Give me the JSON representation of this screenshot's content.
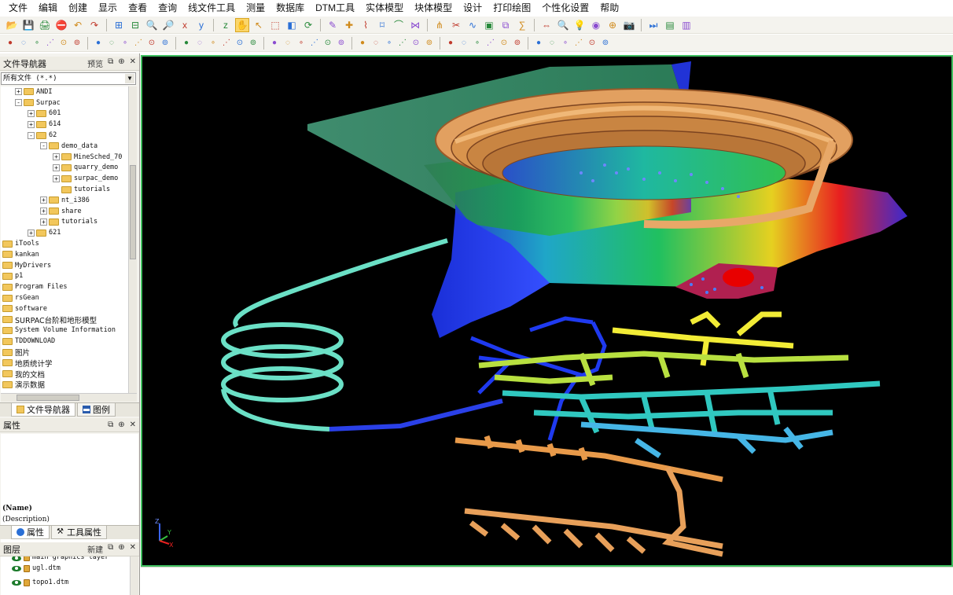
{
  "menubar": {
    "items": [
      "文件",
      "编辑",
      "创建",
      "显示",
      "查看",
      "查询",
      "线文件工具",
      "测量",
      "数据库",
      "DTM工具",
      "实体模型",
      "块体模型",
      "设计",
      "打印绘图",
      "个性化设置",
      "帮助"
    ]
  },
  "toolbar1": {
    "icons": [
      "open-icon",
      "save-icon",
      "print-icon",
      "stop-icon",
      "undo-icon",
      "redo-icon",
      "zoom-box-icon",
      "zoom-fit-icon",
      "zoom-in-icon",
      "zoom-out-icon",
      "axis-x-icon",
      "axis-y-icon",
      "axis-z-icon",
      "pan-icon",
      "select-arrow-icon",
      "select-box-icon",
      "layer-tool-icon",
      "refresh-icon",
      "digitize-icon",
      "crosshair-icon",
      "edit-string-icon",
      "edit-point-icon",
      "edit-segment-icon",
      "join-icon",
      "split-icon",
      "clip-icon",
      "curve-icon",
      "image-icon",
      "copy-icon",
      "calc-icon",
      "move-icon",
      "search-icon",
      "pin-icon",
      "target-icon",
      "snap-icon",
      "photo-icon",
      "next-icon",
      "tool-a-icon",
      "tool-b-icon"
    ]
  },
  "toolbar2": {
    "icons": [
      "pt-1-icon",
      "pt-2-icon",
      "pt-3-icon",
      "pt-4-icon",
      "pt-5-icon",
      "pt-6-icon",
      "pt-7-icon",
      "pt-8-icon",
      "pt-9-icon",
      "pt-10-icon",
      "pt-11-icon",
      "pt-12-icon",
      "pt-13-icon",
      "pt-14-icon",
      "pt-15-icon",
      "pt-16-icon",
      "pt-17-icon",
      "pt-18-icon",
      "pt-19-icon",
      "pt-20-icon",
      "pt-21-icon",
      "pt-22-icon",
      "pt-23-icon",
      "pt-24-icon",
      "pt-25-icon",
      "pt-26-icon",
      "pt-27-icon",
      "pt-28-icon",
      "pt-29-icon",
      "pt-30-icon",
      "pt-31-icon",
      "pt-32-icon",
      "pt-33-icon",
      "pt-34-icon",
      "pt-35-icon",
      "pt-36-icon",
      "pt-37-icon",
      "pt-38-icon",
      "pt-39-icon",
      "pt-40-icon",
      "pt-41-icon",
      "pt-42-icon"
    ]
  },
  "navigator": {
    "title": "文件导航器",
    "preview_label": "预览",
    "filter_value": "所有文件 (*.*)",
    "tree": [
      {
        "label": "ANDI",
        "depth": 1,
        "expander": "+"
      },
      {
        "label": "Surpac",
        "depth": 1,
        "expander": "-"
      },
      {
        "label": "601",
        "depth": 2,
        "expander": "+"
      },
      {
        "label": "614",
        "depth": 2,
        "expander": "+"
      },
      {
        "label": "62",
        "depth": 2,
        "expander": "-"
      },
      {
        "label": "demo_data",
        "depth": 3,
        "expander": "-"
      },
      {
        "label": "MineSched_70",
        "depth": 4,
        "expander": "+"
      },
      {
        "label": "quarry_demo",
        "depth": 4,
        "expander": "+"
      },
      {
        "label": "surpac_demo",
        "depth": 4,
        "expander": "+"
      },
      {
        "label": "tutorials",
        "depth": 4,
        "expander": ""
      },
      {
        "label": "nt_i386",
        "depth": 3,
        "expander": "+"
      },
      {
        "label": "share",
        "depth": 3,
        "expander": "+"
      },
      {
        "label": "tutorials",
        "depth": 3,
        "expander": "+"
      },
      {
        "label": "621",
        "depth": 2,
        "expander": "+"
      },
      {
        "label": "iTools",
        "depth": 0,
        "expander": ""
      },
      {
        "label": "kankan",
        "depth": 0,
        "expander": ""
      },
      {
        "label": "MyDrivers",
        "depth": 0,
        "expander": ""
      },
      {
        "label": "p1",
        "depth": 0,
        "expander": ""
      },
      {
        "label": "Program Files",
        "depth": 0,
        "expander": ""
      },
      {
        "label": "rsGean",
        "depth": 0,
        "expander": ""
      },
      {
        "label": "software",
        "depth": 0,
        "expander": ""
      },
      {
        "label": "SURPAC台阶和地形模型",
        "depth": 0,
        "expander": ""
      },
      {
        "label": "System Volume Information",
        "depth": 0,
        "expander": ""
      },
      {
        "label": "TDDOWNLOAD",
        "depth": 0,
        "expander": ""
      },
      {
        "label": "图片",
        "depth": 0,
        "expander": ""
      },
      {
        "label": "地质统计学",
        "depth": 0,
        "expander": ""
      },
      {
        "label": "我的文档",
        "depth": 0,
        "expander": ""
      },
      {
        "label": "演示数据",
        "depth": 0,
        "expander": ""
      }
    ],
    "tabs": [
      "文件导航器",
      "图例"
    ]
  },
  "properties": {
    "title": "属性",
    "name_placeholder": "(Name)",
    "description_placeholder": "(Description)",
    "tabs": [
      "属性",
      "工具属性"
    ]
  },
  "layers": {
    "title": "图层",
    "new_label": "新建",
    "items": [
      "main graphics layer",
      "ugl.dtm",
      "topo1.dtm"
    ]
  },
  "viewport": {
    "background": "#000000",
    "border": "#3fbf5f",
    "axis_labels": [
      "Z",
      "Y",
      "X"
    ]
  }
}
